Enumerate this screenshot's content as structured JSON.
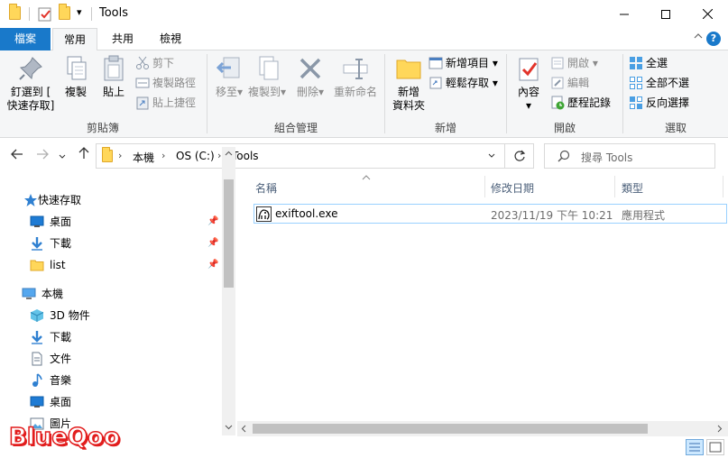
{
  "titlebar": {
    "title": "Tools",
    "qa_dropdown": "▾"
  },
  "ribbon_tabs": [
    "檔案",
    "常用",
    "共用",
    "檢視"
  ],
  "ribbon": {
    "clipboard": {
      "pin_label": "釘選到 [\n快速存取]",
      "copy_label": "複製",
      "paste_label": "貼上",
      "cut_label": "剪下",
      "copy_path_label": "複製路徑",
      "paste_shortcut_label": "貼上捷徑",
      "group_label": "剪貼簿"
    },
    "organize": {
      "move_label": "移至",
      "copyto_label": "複製到",
      "delete_label": "刪除",
      "rename_label": "重新命名",
      "group_label": "組合管理"
    },
    "new": {
      "new_folder_label": "新增\n資料夾",
      "new_item_label": "新增項目",
      "easy_access_label": "輕鬆存取",
      "group_label": "新增"
    },
    "open": {
      "properties_label": "內容",
      "open_label": "開啟",
      "edit_label": "編輯",
      "history_label": "歷程記錄",
      "group_label": "開啟"
    },
    "select": {
      "select_all_label": "全選",
      "select_none_label": "全部不選",
      "invert_label": "反向選擇",
      "group_label": "選取"
    }
  },
  "address": {
    "crumbs": [
      "本機",
      "OS (C:)",
      "Tools"
    ],
    "search_placeholder": "搜尋 Tools"
  },
  "nav": {
    "quick_access": "快速存取",
    "quick_items": [
      "桌面",
      "下載",
      "list"
    ],
    "this_pc": "本機",
    "pc_items": [
      "3D 物件",
      "下載",
      "文件",
      "音樂",
      "桌面",
      "圖片"
    ]
  },
  "files": {
    "columns": [
      "名稱",
      "修改日期",
      "類型"
    ],
    "rows": [
      {
        "name": "exiftool.exe",
        "modified": "2023/11/19 下午 10:21",
        "type": "應用程式"
      }
    ]
  },
  "watermark": "BlueQoo",
  "colors": {
    "file_tab": "#1979ca",
    "ribbon_bg": "#f5f6f7",
    "selection_border": "#99d1ff",
    "watermark": "#e21d1d"
  }
}
